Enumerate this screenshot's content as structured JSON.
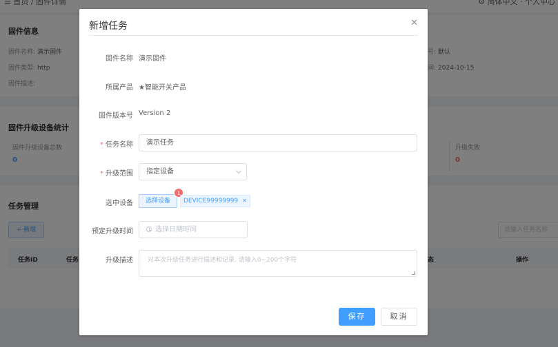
{
  "background": {
    "breadcrumb": "☰  首页 / 固件详情",
    "user": "⚙ 简体中文 · 个人中心",
    "firmware_info": {
      "title": "固件信息",
      "name_label": "固件名称:",
      "name_value": "演示固件",
      "type_label": "固件类型:",
      "type_value": "http",
      "desc_label": "固件描述:",
      "right1_label": "号:",
      "right1_value": "默认",
      "right2_label": "间:",
      "right2_value": "2024-10-15"
    },
    "stats": {
      "title": "固件升级设备统计",
      "total_label": "固件升级设备总数",
      "total_value": "0",
      "fail_label": "升级失败",
      "fail_value": "0"
    },
    "tasks": {
      "title": "任务管理",
      "add_label": "+ 新增",
      "search_placeholder": "请输入任务名称",
      "col_id": "任务ID",
      "col_name": "任务",
      "col_state": "态",
      "col_action": "操作"
    }
  },
  "dialog": {
    "title": "新增任务",
    "close_icon": "close-icon",
    "fields": {
      "firmware_name_label": "固件名称",
      "firmware_name_value": "演示固件",
      "product_label": "所属产品",
      "product_value": "★智能开关产品",
      "version_label": "固件版本号",
      "version_value": "Version 2",
      "task_name_label": "任务名称",
      "task_name_value": "演示任务",
      "scope_label": "升级范围",
      "scope_value": "指定设备",
      "device_label": "选中设备",
      "select_device_button": "选择设备",
      "device_count_badge": "1",
      "device_tag": "DEVICE99999999",
      "time_label": "预定升级时间",
      "time_placeholder": "选择日期时间",
      "desc_label": "升级描述",
      "desc_placeholder": "对本次升级任务进行描述和记录, 请输入0~200个字符"
    },
    "save_button": "保存",
    "cancel_button": "取消"
  }
}
